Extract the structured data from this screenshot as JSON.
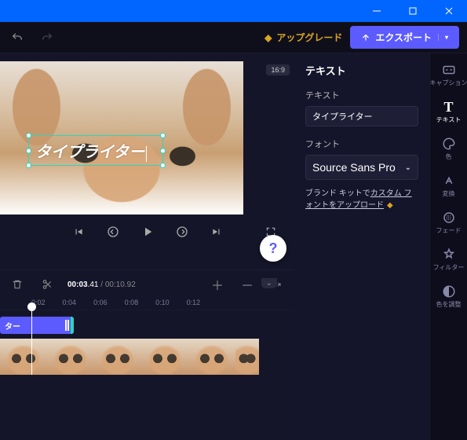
{
  "titlebar": {
    "min": "—",
    "max": "□",
    "close": "×"
  },
  "topbar": {
    "upgrade_label": "アップグレード",
    "export_label": "エクスポート"
  },
  "preview": {
    "aspect": "16:9",
    "text_overlay": "タイプライター"
  },
  "controls": {
    "help": "?"
  },
  "timeline": {
    "current": "00:03",
    "current_frac": ".41",
    "total": "00:10",
    "total_frac": ".92",
    "ruler": [
      "0:02",
      "0:04",
      "0:06",
      "0:08",
      "0:10",
      "0:12"
    ],
    "text_clip_label": "ター"
  },
  "panel": {
    "title": "テキスト",
    "text_label": "テキスト",
    "text_value": "タイプライター",
    "font_label": "フォント",
    "font_value": "Source Sans Pro",
    "brand_prefix": "ブランド キットで",
    "brand_link": "カスタム フォントをアップロード"
  },
  "sidebar": {
    "caption": "キャプション",
    "text": "テキスト",
    "color": "色",
    "transform": "変換",
    "fade": "フェード",
    "filter": "フィルター",
    "adjust": "色を調整"
  }
}
